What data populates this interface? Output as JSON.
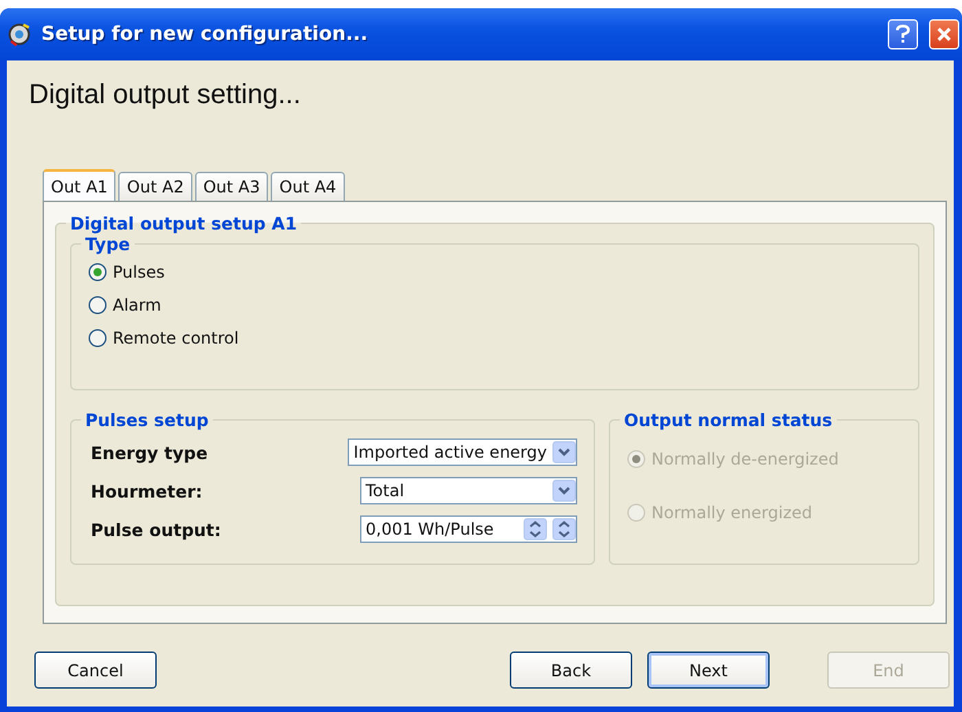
{
  "window": {
    "title": "Setup for new configuration...",
    "heading": "Digital output setting..."
  },
  "tabs": [
    {
      "label": "Out A1",
      "selected": true
    },
    {
      "label": "Out A2",
      "selected": false
    },
    {
      "label": "Out A3",
      "selected": false
    },
    {
      "label": "Out A4",
      "selected": false
    }
  ],
  "panel": {
    "title": "Digital output setup A1",
    "type_group": {
      "title": "Type",
      "options": [
        {
          "label": "Pulses",
          "selected": true
        },
        {
          "label": "Alarm",
          "selected": false
        },
        {
          "label": "Remote control",
          "selected": false
        }
      ]
    },
    "pulses_setup": {
      "title": "Pulses setup",
      "fields": [
        {
          "kind": "dropdown",
          "label": "Energy type",
          "value": "Imported active energy"
        },
        {
          "kind": "dropdown",
          "label": "Hourmeter:",
          "value": "Total"
        },
        {
          "kind": "spinner",
          "label": "Pulse output:",
          "value": "0,001 Wh/Pulse"
        }
      ]
    },
    "output_status": {
      "title": "Output normal status",
      "disabled": true,
      "options": [
        {
          "label": "Normally de-energized",
          "selected": true
        },
        {
          "label": "Normally energized",
          "selected": false
        }
      ]
    }
  },
  "buttons": [
    {
      "label": "Cancel",
      "disabled": false,
      "default": false
    },
    {
      "label": "Back",
      "disabled": false,
      "default": false
    },
    {
      "label": "Next",
      "disabled": false,
      "default": true
    },
    {
      "label": "End",
      "disabled": true,
      "default": false
    }
  ]
}
